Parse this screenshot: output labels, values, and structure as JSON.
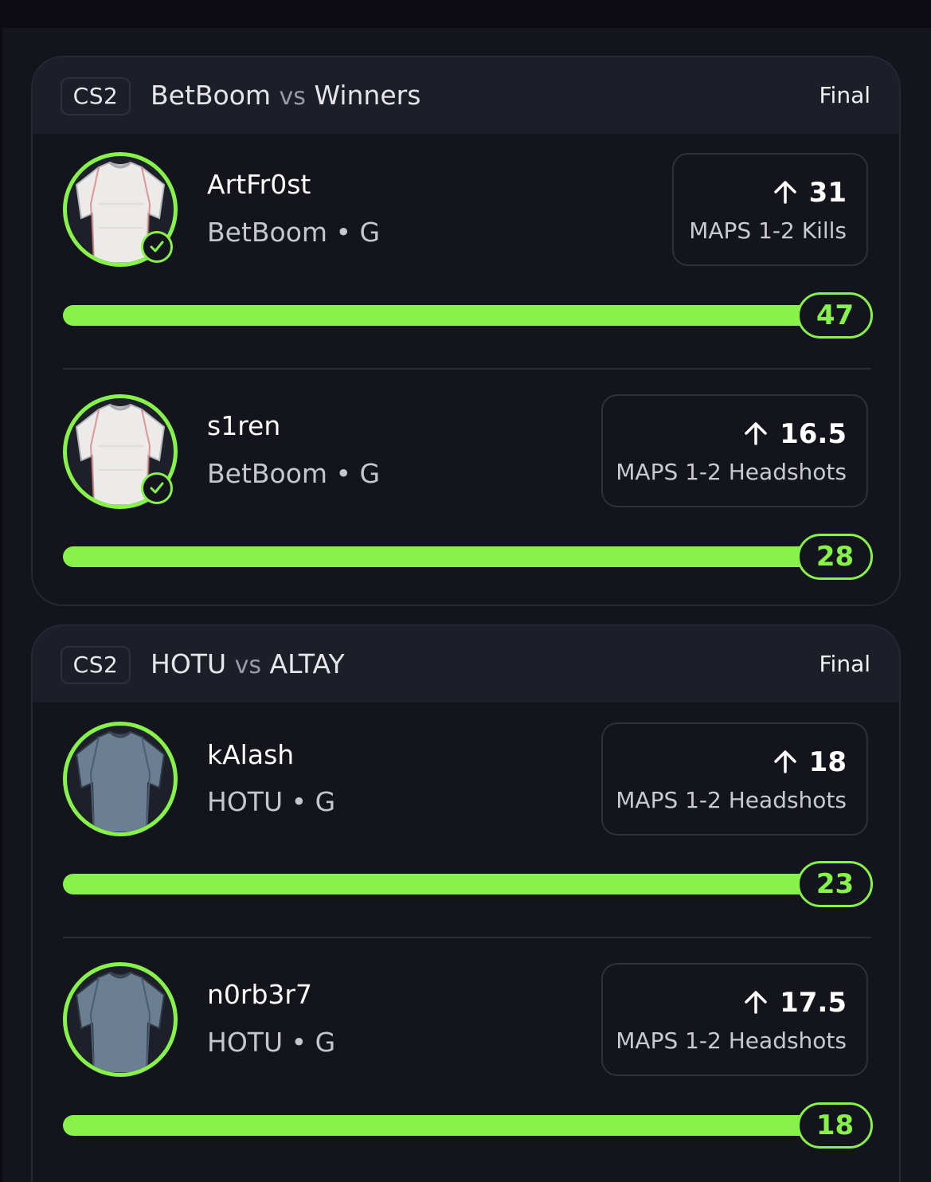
{
  "accent_color": "#86f24a",
  "matches": [
    {
      "game": "CS2",
      "team_a": "BetBoom",
      "vs": "vs",
      "team_b": "Winners",
      "status": "Final",
      "picks": [
        {
          "player": "ArtFr0st",
          "team": "BetBoom",
          "separator": "•",
          "position": "G",
          "jersey": "white-jersey-icon",
          "check": true,
          "direction_icon": "arrow-up-icon",
          "line": "31",
          "stat": "MAPS 1-2 Kills",
          "result": "47"
        },
        {
          "player": "s1ren",
          "team": "BetBoom",
          "separator": "•",
          "position": "G",
          "jersey": "white-jersey-icon",
          "check": true,
          "direction_icon": "arrow-up-icon",
          "line": "16.5",
          "stat": "MAPS 1-2 Headshots",
          "result": "28"
        }
      ]
    },
    {
      "game": "CS2",
      "team_a": "HOTU",
      "vs": "vs",
      "team_b": "ALTAY",
      "status": "Final",
      "picks": [
        {
          "player": "kAlash",
          "team": "HOTU",
          "separator": "•",
          "position": "G",
          "jersey": "blue-jersey-icon",
          "check": false,
          "direction_icon": "arrow-up-icon",
          "line": "18",
          "stat": "MAPS 1-2 Headshots",
          "result": "23"
        },
        {
          "player": "n0rb3r7",
          "team": "HOTU",
          "separator": "•",
          "position": "G",
          "jersey": "blue-jersey-icon",
          "check": false,
          "direction_icon": "arrow-up-icon",
          "line": "17.5",
          "stat": "MAPS 1-2 Headshots",
          "result": "18"
        }
      ]
    }
  ]
}
